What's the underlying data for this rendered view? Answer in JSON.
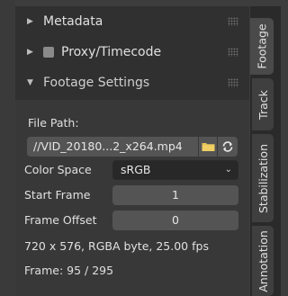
{
  "sections": {
    "metadata": {
      "label": "Metadata"
    },
    "proxy": {
      "label": "Proxy/Timecode"
    },
    "footage_settings": {
      "label": "Footage Settings"
    }
  },
  "footage": {
    "file_path_label": "File Path:",
    "file_path_value": "//VID_20180...2_x264.mp4",
    "color_space_label": "Color Space",
    "color_space_value": "sRGB",
    "start_frame_label": "Start Frame",
    "start_frame_value": "1",
    "frame_offset_label": "Frame Offset",
    "frame_offset_value": "0",
    "info_line": "720 x 576, RGBA byte, 25.00 fps",
    "frame_line": "Frame: 95 / 295"
  },
  "tabs": [
    {
      "label": "Footage",
      "active": true
    },
    {
      "label": "Track",
      "active": false
    },
    {
      "label": "Stabilization",
      "active": false
    },
    {
      "label": "Annotation",
      "active": false
    }
  ],
  "icons": {
    "collapsed": "triangle-right-icon",
    "expanded": "triangle-down-icon",
    "folder": "folder-icon",
    "reload": "reload-icon",
    "dropdown": "chevron-down-icon"
  },
  "colors": {
    "panel_bg": "#303030",
    "content_bg": "#383838",
    "field_bg": "#545454",
    "select_bg": "#282828",
    "folder_yellow": "#e6c35a"
  }
}
